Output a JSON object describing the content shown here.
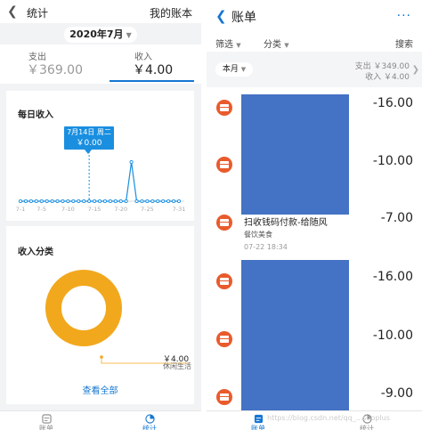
{
  "left": {
    "title": "统计",
    "my_account": "我的账本",
    "month": "2020年7月",
    "expense": {
      "label": "支出",
      "value": "￥369.00"
    },
    "income": {
      "label": "收入",
      "value": "￥4.00"
    },
    "daily_title": "每日收入",
    "tooltip": {
      "date": "7月14日 周二",
      "value": "￥0.00"
    },
    "category_title": "收入分类",
    "legend": {
      "value": "￥4.00",
      "category": "休闲生活"
    },
    "view_all": "查看全部",
    "tabs": [
      "账单",
      "统计"
    ],
    "accent": "#1677d2"
  },
  "chart_data": [
    {
      "type": "line",
      "title": "每日收入",
      "x": [
        "7-1",
        "7-2",
        "7-3",
        "7-4",
        "7-5",
        "7-6",
        "7-7",
        "7-8",
        "7-9",
        "7-10",
        "7-11",
        "7-12",
        "7-13",
        "7-14",
        "7-15",
        "7-16",
        "7-17",
        "7-18",
        "7-19",
        "7-20",
        "7-21",
        "7-22",
        "7-23",
        "7-24",
        "7-25",
        "7-26",
        "7-27",
        "7-28",
        "7-29",
        "7-30",
        "7-31"
      ],
      "tick_labels": [
        "7-1",
        "7-5",
        "7-10",
        "7-15",
        "7-20",
        "7-25",
        "7-31"
      ],
      "series": [
        {
          "values": [
            0,
            0,
            0,
            0,
            0,
            0,
            0,
            0,
            0,
            0,
            0,
            0,
            0,
            0,
            0,
            0,
            0,
            0,
            0,
            0,
            0,
            4,
            0,
            0,
            0,
            0,
            0,
            0,
            0,
            0,
            0
          ]
        }
      ],
      "color": "#1a8fe0"
    },
    {
      "type": "pie",
      "title": "收入分类",
      "labels": [
        "休闲生活"
      ],
      "values": [
        4.0
      ],
      "color": "#f2a81d"
    }
  ],
  "right": {
    "title": "账单",
    "more": "···",
    "filter": "筛选",
    "category": "分类",
    "search": "搜索",
    "month": "本月",
    "expense_total": "支出 ￥349.00",
    "income_total": "收入 ￥4.00",
    "rows": [
      {
        "amount": "-16.00"
      },
      {
        "amount": "-10.00"
      },
      {
        "amount": "-7.00",
        "name": "扫收钱码付款-给随风",
        "sub": "餐饮美食",
        "time": "07-22  18:34"
      },
      {
        "amount": "-16.00"
      },
      {
        "amount": "-10.00"
      },
      {
        "amount": "-9.00"
      }
    ],
    "tabs": [
      "账单",
      "统计"
    ]
  },
  "watermark": "https://blog.csdn.net/qq_...sooplus"
}
